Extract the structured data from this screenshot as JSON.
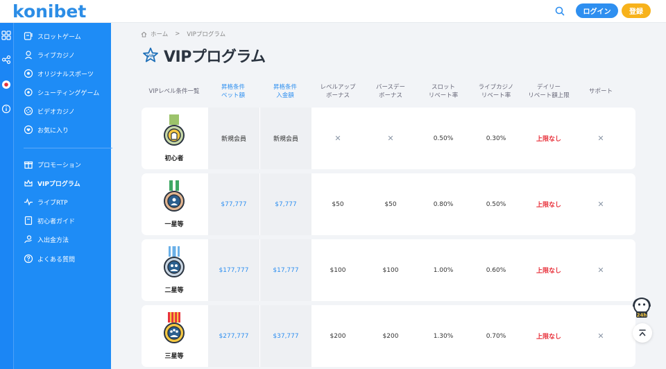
{
  "header": {
    "logo": "konibet",
    "login_label": "ログイン",
    "register_label": "登録"
  },
  "sidebar": {
    "items": [
      {
        "label": "スロットゲーム",
        "icon": "slot-icon"
      },
      {
        "label": "ライブカジノ",
        "icon": "dealer-icon"
      },
      {
        "label": "オリジナルスポーツ",
        "icon": "ball-icon"
      },
      {
        "label": "シューティングゲーム",
        "icon": "target-icon"
      },
      {
        "label": "ビデオカジノ",
        "icon": "chip-icon"
      },
      {
        "label": "お気に入り",
        "icon": "heart-icon"
      },
      {
        "label": "プロモーション",
        "icon": "gift-icon"
      },
      {
        "label": "VIPプログラム",
        "icon": "crown-icon"
      },
      {
        "label": "ライブRTP",
        "icon": "pulse-icon"
      },
      {
        "label": "初心者ガイド",
        "icon": "book-icon"
      },
      {
        "label": "入出金方法",
        "icon": "hand-coin-icon"
      },
      {
        "label": "よくある質問",
        "icon": "question-icon"
      }
    ]
  },
  "breadcrumb": {
    "home": "ホーム",
    "separator": ">",
    "current": "VIPプログラム"
  },
  "page": {
    "title": "VIPプログラム",
    "badge": "VIP"
  },
  "table": {
    "headers": [
      {
        "line1": "VIPレベル条件一覧",
        "line2": ""
      },
      {
        "line1": "昇格条件",
        "line2": "ベット額"
      },
      {
        "line1": "昇格条件",
        "line2": "入金額"
      },
      {
        "line1": "レベルアップ",
        "line2": "ボーナス"
      },
      {
        "line1": "バースデー",
        "line2": "ボーナス"
      },
      {
        "line1": "スロット",
        "line2": "リベート率"
      },
      {
        "line1": "ライブカジノ",
        "line2": "リベート率"
      },
      {
        "line1": "デイリー",
        "line2": "リベート額上限"
      },
      {
        "line1": "サポート",
        "line2": ""
      }
    ],
    "rows": [
      {
        "rank": "初心者",
        "bet": "新規会員",
        "deposit": "新規会員",
        "levelup": "✕",
        "birthday": "✕",
        "slot": "0.50%",
        "live": "0.30%",
        "daily": "上限なし",
        "support": "✕"
      },
      {
        "rank": "一星等",
        "bet": "$77,777",
        "deposit": "$7,777",
        "levelup": "$50",
        "birthday": "$50",
        "slot": "0.80%",
        "live": "0.50%",
        "daily": "上限なし",
        "support": "✕"
      },
      {
        "rank": "二星等",
        "bet": "$177,777",
        "deposit": "$17,777",
        "levelup": "$100",
        "birthday": "$100",
        "slot": "1.00%",
        "live": "0.60%",
        "daily": "上限なし",
        "support": "✕"
      },
      {
        "rank": "三星等",
        "bet": "$277,777",
        "deposit": "$37,777",
        "levelup": "$200",
        "birthday": "$200",
        "slot": "1.30%",
        "live": "0.70%",
        "daily": "上限なし",
        "support": "✕"
      }
    ]
  },
  "support_widget": {
    "label": "24h"
  },
  "colors": {
    "brand": "#1e8cf6",
    "login": "#2e8ff0",
    "register": "#f7b21b",
    "no_limit": "#e8323c"
  }
}
